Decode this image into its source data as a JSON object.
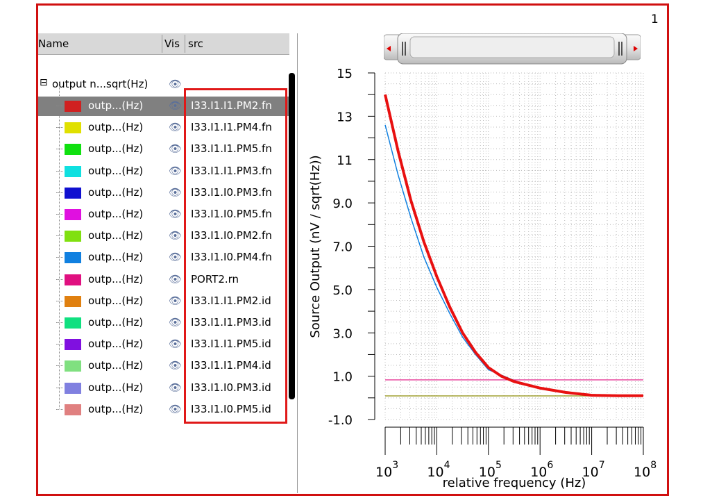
{
  "page_number": "1",
  "table": {
    "headers": [
      "Name",
      "Vis",
      "src"
    ],
    "group": {
      "name": "output n...sqrt(Hz)"
    },
    "rows": [
      {
        "name": "outp...(Hz)",
        "src": "I33.I1.I1.PM2.fn",
        "color": "#d02020",
        "selected": true
      },
      {
        "name": "outp...(Hz)",
        "src": "I33.I1.I1.PM4.fn",
        "color": "#e0e000"
      },
      {
        "name": "outp...(Hz)",
        "src": "I33.I1.I1.PM5.fn",
        "color": "#10e010"
      },
      {
        "name": "outp...(Hz)",
        "src": "I33.I1.I1.PM3.fn",
        "color": "#10e0e0"
      },
      {
        "name": "outp...(Hz)",
        "src": "I33.I1.I0.PM3.fn",
        "color": "#1010d0"
      },
      {
        "name": "outp...(Hz)",
        "src": "I33.I1.I0.PM5.fn",
        "color": "#e010e0"
      },
      {
        "name": "outp...(Hz)",
        "src": "I33.I1.I0.PM2.fn",
        "color": "#80e010"
      },
      {
        "name": "outp...(Hz)",
        "src": "I33.I1.I0.PM4.fn",
        "color": "#1080e0"
      },
      {
        "name": "outp...(Hz)",
        "src": "PORT2.rn",
        "color": "#e01080"
      },
      {
        "name": "outp...(Hz)",
        "src": "I33.I1.I1.PM2.id",
        "color": "#e08010"
      },
      {
        "name": "outp...(Hz)",
        "src": "I33.I1.I1.PM3.id",
        "color": "#10e080"
      },
      {
        "name": "outp...(Hz)",
        "src": "I33.I1.I1.PM5.id",
        "color": "#8010e0"
      },
      {
        "name": "outp...(Hz)",
        "src": "I33.I1.I1.PM4.id",
        "color": "#80e080"
      },
      {
        "name": "outp...(Hz)",
        "src": "I33.I1.I0.PM3.id",
        "color": "#8080e0"
      },
      {
        "name": "outp...(Hz)",
        "src": "I33.I1.I0.PM5.id",
        "color": "#e08080"
      }
    ]
  },
  "chart_data": {
    "type": "line",
    "title": "",
    "xlabel": "relative frequency (Hz)",
    "ylabel": "Source Output (nV / sqrt(Hz))",
    "xscale": "log",
    "xlim": [
      1000,
      100000000
    ],
    "ylim": [
      -1,
      15
    ],
    "yticks": [
      "15",
      "13",
      "11",
      "9.0",
      "7.0",
      "5.0",
      "3.0",
      "1.0",
      "-1.0"
    ],
    "ytick_values": [
      15,
      13,
      11,
      9,
      7,
      5,
      3,
      1,
      -1
    ],
    "xticks": [
      {
        "base": "10",
        "exp": "3"
      },
      {
        "base": "10",
        "exp": "4"
      },
      {
        "base": "10",
        "exp": "5"
      },
      {
        "base": "10",
        "exp": "6"
      },
      {
        "base": "10",
        "exp": "7"
      },
      {
        "base": "10",
        "exp": "8"
      }
    ],
    "grid": true,
    "series": [
      {
        "name": "I33.I1.I0.PM4.fn",
        "color": "#1080e0",
        "width": 1.5,
        "log10x": [
          3,
          3.25,
          3.5,
          3.75,
          4,
          4.25,
          4.5,
          4.75,
          5,
          5.5,
          6,
          7,
          8
        ],
        "y": [
          12.6,
          10.3,
          8.3,
          6.5,
          5.1,
          3.9,
          2.8,
          2.0,
          1.3,
          0.8,
          0.45,
          0.12,
          0.1
        ]
      },
      {
        "name": "PORT2.rn",
        "color": "#e01080",
        "width": 1.2,
        "log10x": [
          3,
          8
        ],
        "y": [
          0.83,
          0.83
        ]
      },
      {
        "name": "I33.I1.I1.PM2.id",
        "color": "#a0a030",
        "width": 1.5,
        "log10x": [
          3,
          8
        ],
        "y": [
          0.09,
          0.09
        ]
      },
      {
        "name": "I33.I1.I1.PM2.fn",
        "color": "#e81010",
        "width": 4,
        "log10x": [
          3,
          3.25,
          3.5,
          3.75,
          4,
          4.25,
          4.5,
          4.75,
          5,
          5.25,
          5.5,
          6,
          6.5,
          7,
          7.5,
          8
        ],
        "y": [
          14.0,
          11.4,
          9.1,
          7.2,
          5.6,
          4.2,
          3.0,
          2.1,
          1.4,
          1.0,
          0.75,
          0.45,
          0.25,
          0.12,
          0.1,
          0.1
        ]
      }
    ]
  }
}
